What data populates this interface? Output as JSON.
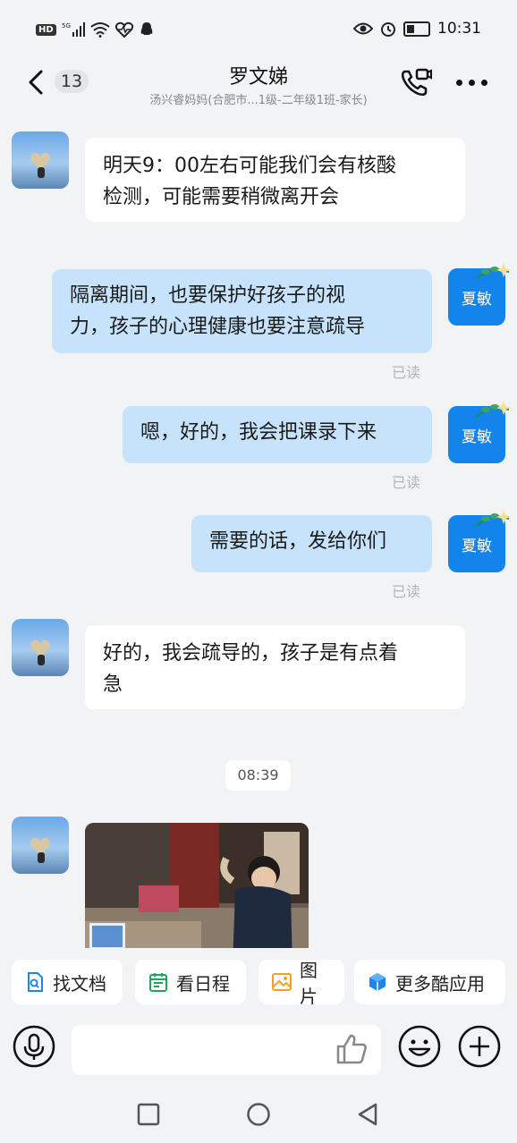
{
  "status": {
    "hd": "HD",
    "net": "5G",
    "time": "10:31"
  },
  "header": {
    "unread_count": "13",
    "title": "罗文娣",
    "subtitle": "汤兴睿妈妈(合肥市...1级-二年级1班-家长)"
  },
  "messages": [
    {
      "from": "other",
      "text_lines": [
        "明天9：00左右可能我们会有核酸",
        "检测，可能需要稍微离开会"
      ]
    },
    {
      "from": "me",
      "avatar": "夏敏",
      "text_lines": [
        "隔离期间，也要保护好孩子的视",
        "力，孩子的心理健康也要注意疏导"
      ],
      "status": "已读"
    },
    {
      "from": "me",
      "avatar": "夏敏",
      "text_lines": [
        "嗯，好的，我会把课录下来"
      ],
      "status": "已读"
    },
    {
      "from": "me",
      "avatar": "夏敏",
      "text_lines": [
        "需要的话，发给你们"
      ],
      "status": "已读"
    },
    {
      "from": "other",
      "text_lines": [
        "好的，我会疏导的，孩子是有点着",
        "急"
      ]
    }
  ],
  "time_separator": "08:39",
  "quick_actions": [
    {
      "label": "找文档",
      "icon": "document-search-icon",
      "color": "#1a86f0"
    },
    {
      "label": "看日程",
      "icon": "calendar-icon",
      "color": "#19a85a"
    },
    {
      "label": "图片",
      "icon": "image-icon",
      "color": "#f3a21c"
    },
    {
      "label": "更多酷应用",
      "icon": "apps-cube-icon",
      "color": "#1a86f0"
    }
  ],
  "colors": {
    "accent": "#1384ec",
    "outgoing_bubble": "#c7e3fb",
    "background": "#f2f3f5"
  }
}
